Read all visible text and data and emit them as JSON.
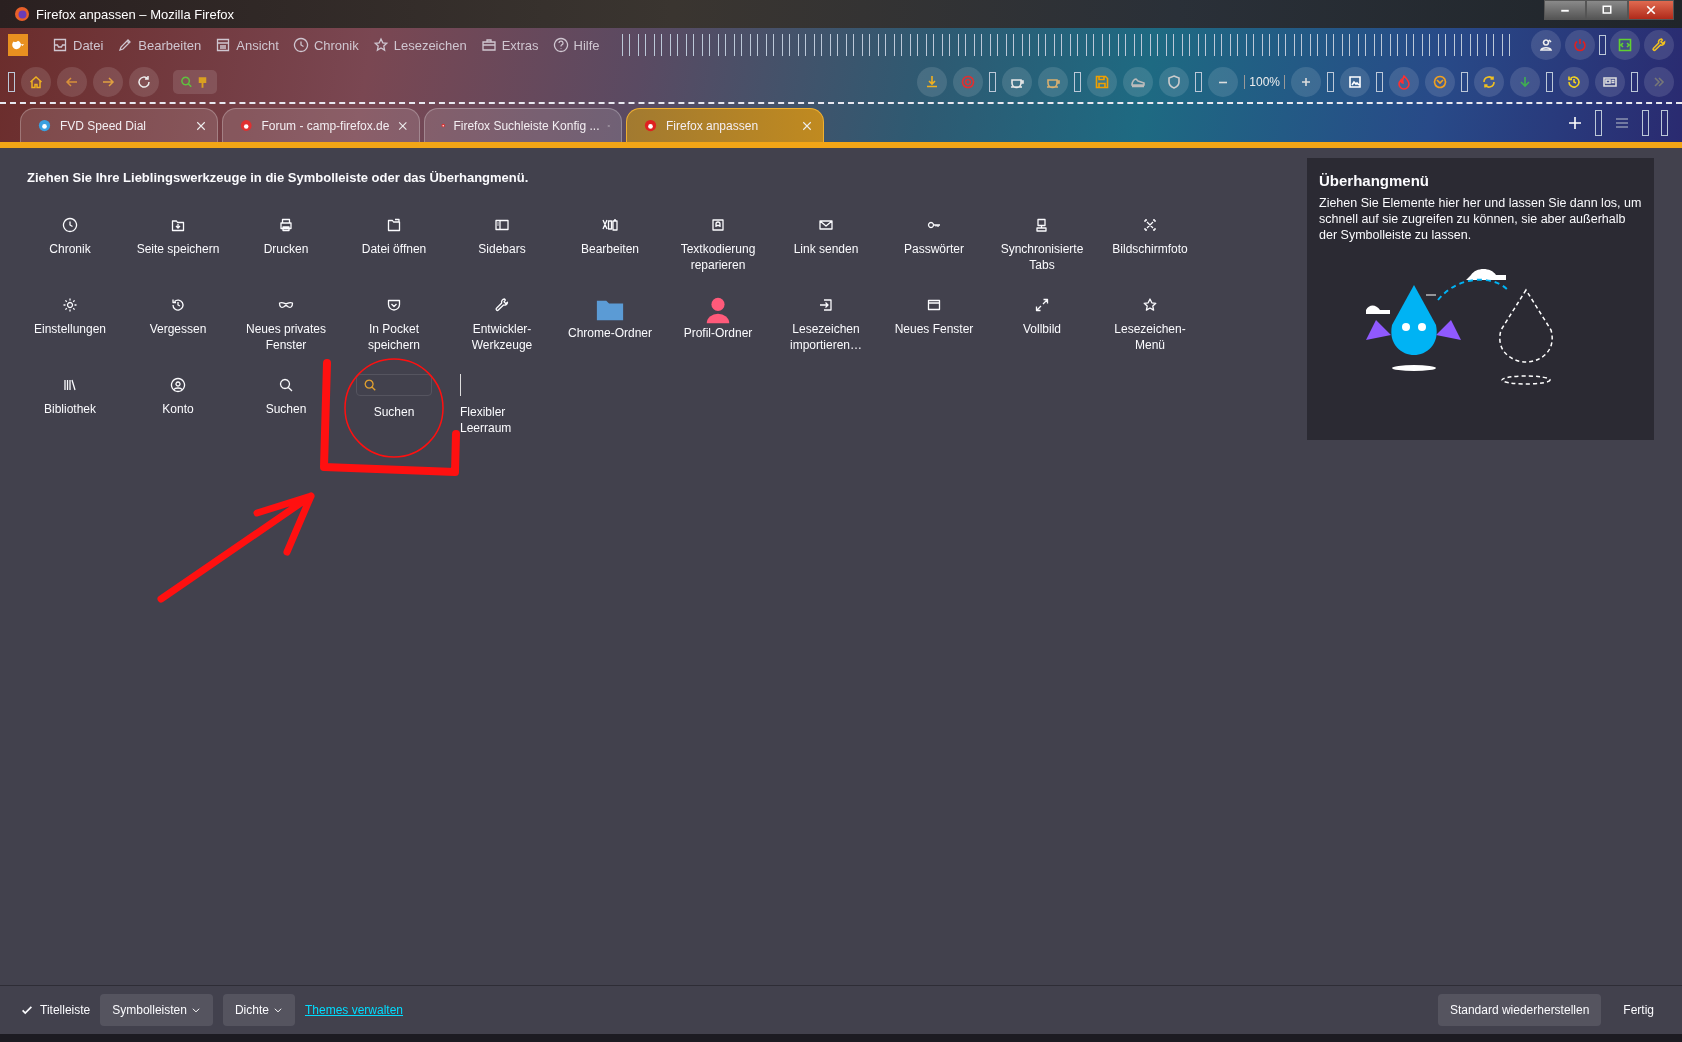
{
  "window": {
    "title": "Firefox anpassen – Mozilla Firefox"
  },
  "menu_bar": {
    "items": [
      "Datei",
      "Bearbeiten",
      "Ansicht",
      "Chronik",
      "Lesezeichen",
      "Extras",
      "Hilfe"
    ]
  },
  "toolbar": {
    "zoom": "100%"
  },
  "tabs": [
    {
      "label": "FVD Speed Dial",
      "selected": false
    },
    {
      "label": "Forum - camp-firefox.de",
      "selected": false
    },
    {
      "label": "Firefox Suchleiste Konfig ...",
      "selected": false
    },
    {
      "label": "Firefox anpassen",
      "selected": true
    }
  ],
  "customize": {
    "heading": "Ziehen Sie Ihre Lieblingswerkzeuge in die Symbolleiste oder das Überhangmenü.",
    "items": [
      {
        "label": "Chronik",
        "kind": "tool"
      },
      {
        "label": "Seite speichern",
        "kind": "tool"
      },
      {
        "label": "Drucken",
        "kind": "tool"
      },
      {
        "label": "Datei öffnen",
        "kind": "tool"
      },
      {
        "label": "Sidebars",
        "kind": "tool"
      },
      {
        "label": "Bearbeiten",
        "kind": "tool"
      },
      {
        "label": "Textkodierung reparieren",
        "kind": "tool"
      },
      {
        "label": "Link senden",
        "kind": "tool"
      },
      {
        "label": "Passwörter",
        "kind": "tool"
      },
      {
        "label": "Synchronisierte Tabs",
        "kind": "tool"
      },
      {
        "label": "Bildschirmfoto",
        "kind": "tool"
      },
      {
        "label": "Einstellungen",
        "kind": "tool"
      },
      {
        "label": "Vergessen",
        "kind": "tool"
      },
      {
        "label": "Neues privates Fenster",
        "kind": "tool"
      },
      {
        "label": "In Pocket speichern",
        "kind": "tool"
      },
      {
        "label": "Entwickler-Werkzeuge",
        "kind": "tool"
      },
      {
        "label": "Chrome-Ordner",
        "kind": "tool"
      },
      {
        "label": "Profil-Ordner",
        "kind": "tool"
      },
      {
        "label": "Lesezeichen importieren…",
        "kind": "tool"
      },
      {
        "label": "Neues Fenster",
        "kind": "tool"
      },
      {
        "label": "Vollbild",
        "kind": "tool"
      },
      {
        "label": "Lesezeichen-Menü",
        "kind": "tool"
      },
      {
        "label": "Bibliothek",
        "kind": "tool"
      },
      {
        "label": "Konto",
        "kind": "tool"
      },
      {
        "label": "Suchen",
        "kind": "tool"
      },
      {
        "label": "Suchen",
        "kind": "search-field"
      },
      {
        "label": "Flexibler Leerraum",
        "kind": "spacer"
      }
    ]
  },
  "overflow_panel": {
    "title": "Überhangmenü",
    "text": "Ziehen Sie Elemente hier her und lassen Sie dann los, um schnell auf sie zugreifen zu können, sie aber außerhalb der Symbolleiste zu lassen."
  },
  "footer": {
    "title_bar_checkbox": {
      "label": "Titelleiste",
      "checked": true
    },
    "toolbars_button": "Symbolleisten",
    "density_button": "Dichte",
    "themes_link": "Themes verwalten",
    "restore_button": "Standard wiederherstellen",
    "done_button": "Fertig"
  }
}
